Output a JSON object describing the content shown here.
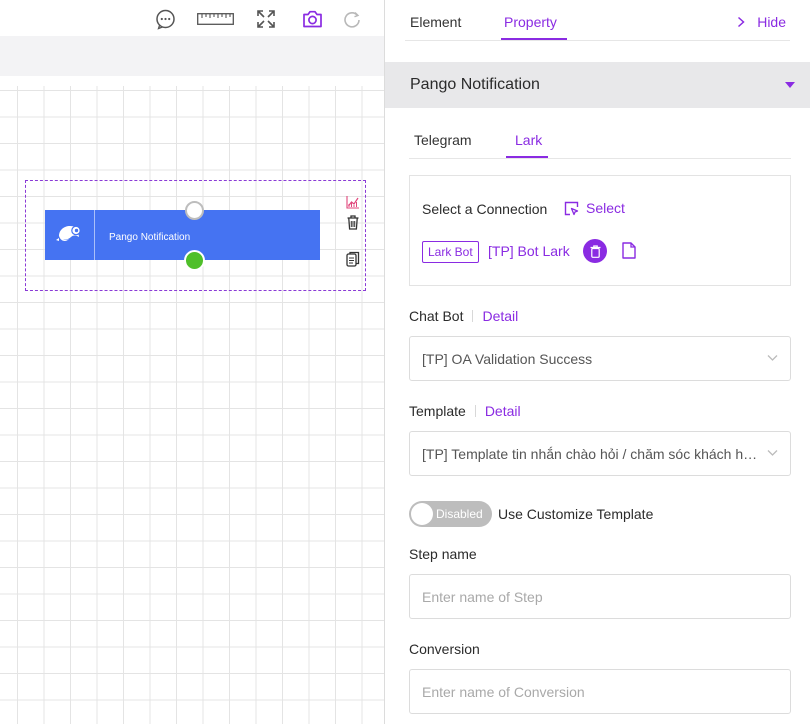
{
  "canvas": {
    "node": {
      "title": "Pango Notification"
    }
  },
  "panel": {
    "tabs": [
      {
        "label": "Element"
      },
      {
        "label": "Property"
      }
    ],
    "hide_label": "Hide",
    "section_title": "Pango Notification",
    "subtabs": [
      {
        "label": "Telegram"
      },
      {
        "label": "Lark"
      }
    ],
    "connection": {
      "label": "Select a Connection",
      "select_label": "Select",
      "tag": "Lark Bot",
      "bot_name": "[TP] Bot Lark"
    },
    "chat_bot": {
      "label": "Chat Bot",
      "detail": "Detail",
      "value": "[TP] OA Validation Success"
    },
    "template": {
      "label": "Template",
      "detail": "Detail",
      "value": "[TP] Template tin nhắn chào hỏi / chăm sóc khách hàng"
    },
    "customize": {
      "toggle_text": "Disabled",
      "label": "Use Customize Template"
    },
    "step_name": {
      "label": "Step name",
      "placeholder": "Enter name of Step"
    },
    "conversion": {
      "label": "Conversion",
      "placeholder": "Enter name of Conversion"
    }
  },
  "colors": {
    "accent": "#8a2be2",
    "node_blue": "#4573f2",
    "success_handle": "#4fbf2a",
    "toggle_off": "#bdbdbd"
  }
}
